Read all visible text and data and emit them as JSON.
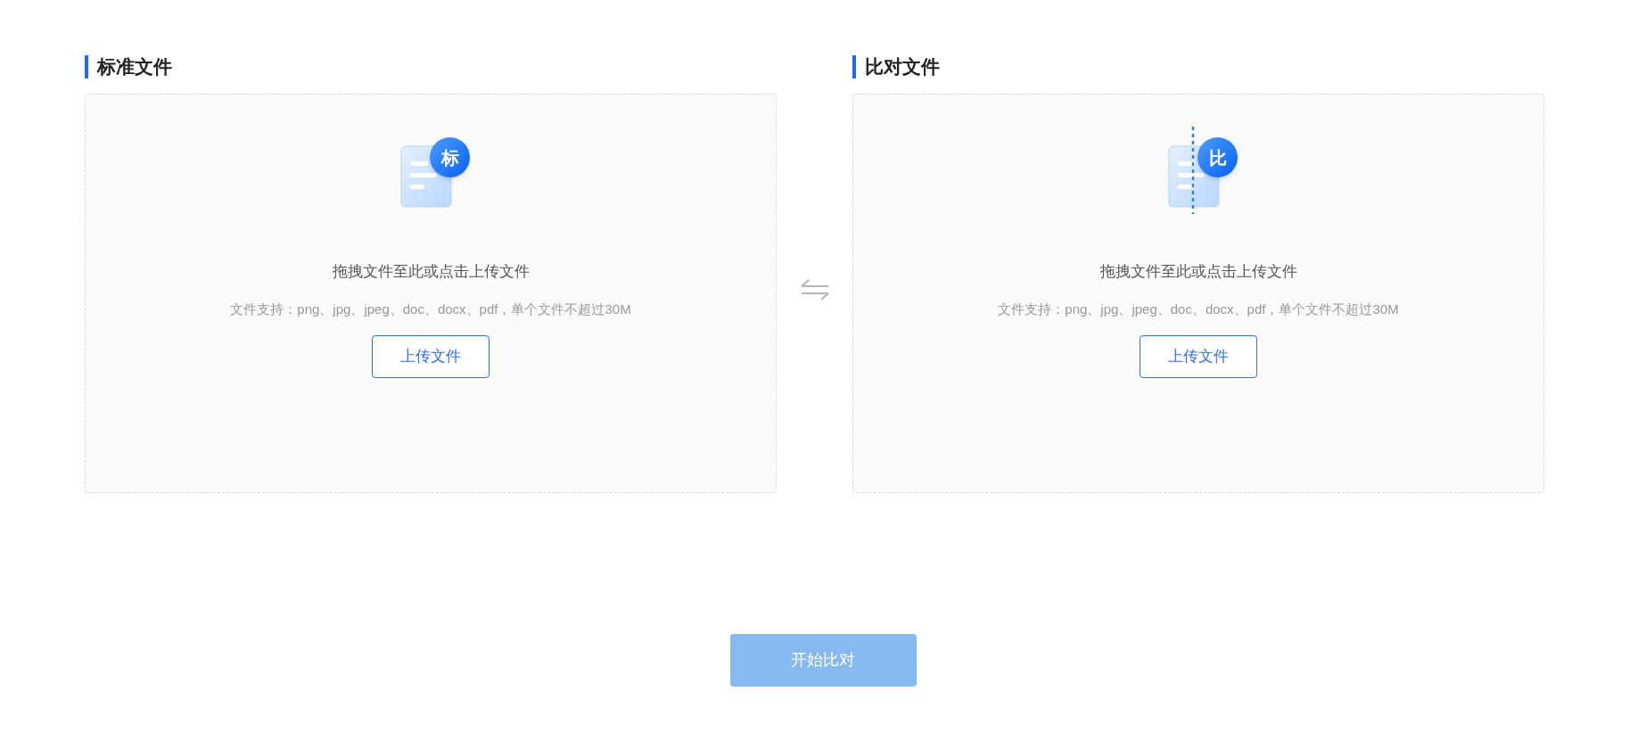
{
  "panels": [
    {
      "kind": "standard",
      "title": "标准文件",
      "badge": "标",
      "prompt": "拖拽文件至此或点击上传文件",
      "hint": "文件支持：png、jpg、jpeg、doc、docx、pdf，单个文件不超过30M",
      "button": "上传文件"
    },
    {
      "kind": "compare",
      "title": "比对文件",
      "badge": "比",
      "prompt": "拖拽文件至此或点击上传文件",
      "hint": "文件支持：png、jpg、jpeg、doc、docx、pdf，单个文件不超过30M",
      "button": "上传文件"
    }
  ],
  "start_button": {
    "label": "开始比对",
    "disabled": true
  }
}
